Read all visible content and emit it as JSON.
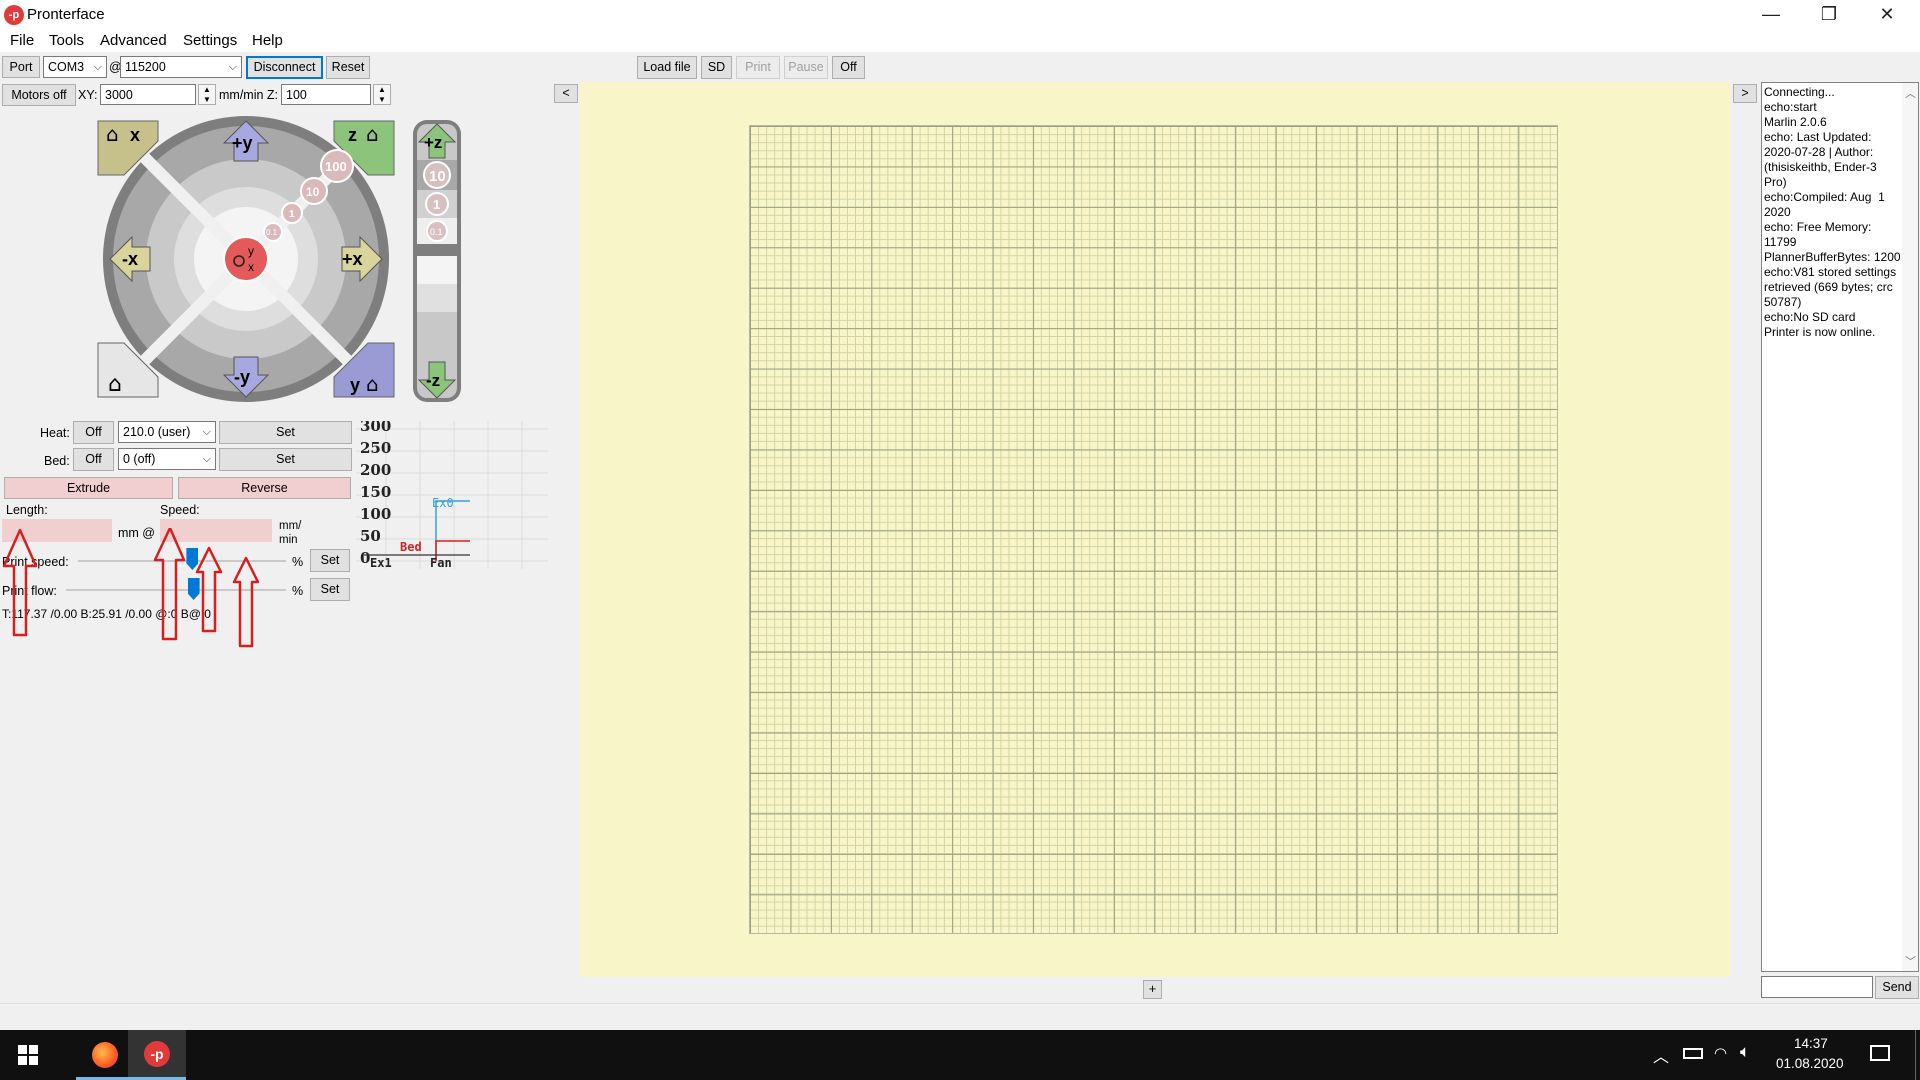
{
  "window": {
    "title": "Pronterface",
    "icon_text": "-p",
    "minimize": "—",
    "restore": "❐",
    "close": "✕"
  },
  "menu": [
    "File",
    "Tools",
    "Advanced",
    "Settings",
    "Help"
  ],
  "toolbar": {
    "port_label": "Port",
    "port_value": "COM3",
    "at_symbol": "@",
    "baud_value": "115200",
    "disconnect_label": "Disconnect",
    "reset_label": "Reset",
    "load_file_label": "Load file",
    "sd_label": "SD",
    "print_label": "Print",
    "pause_label": "Pause",
    "off_label": "Off",
    "collapse_left": "<",
    "collapse_right": ">"
  },
  "motion": {
    "motors_off_label": "Motors off",
    "xy_label": "XY:",
    "xy_value": "3000",
    "xy_unit": "mm/min Z:",
    "z_value": "100"
  },
  "jog": {
    "plus_y": "+y",
    "minus_y": "-y",
    "plus_x": "+x",
    "minus_x": "-x",
    "home_x": "x",
    "home_z": "z",
    "home_y": "y",
    "center_y": "y",
    "center_x": "x",
    "steps": [
      "100",
      "10",
      "1",
      "0.1"
    ],
    "plus_z": "+z",
    "minus_z": "-z",
    "z_steps": [
      "10",
      "1",
      "0.1"
    ]
  },
  "temps": {
    "heat_label": "Heat:",
    "heat_off": "Off",
    "heat_value": "210.0 (user)",
    "heat_set": "Set",
    "bed_label": "Bed:",
    "bed_off": "Off",
    "bed_value": "0 (off)",
    "bed_set": "Set"
  },
  "extrude": {
    "extrude_label": "Extrude",
    "reverse_label": "Reverse",
    "length_label": "Length:",
    "speed_label": "Speed:",
    "mm_at": "mm @",
    "mm_min_line1": "mm/",
    "mm_min_line2": "min",
    "print_speed_label": "Print speed:",
    "print_flow_label": "Print flow:",
    "percent": "%",
    "set": "Set",
    "print_speed_level": 0.55,
    "print_flow_level": 0.58
  },
  "status_line": "T:117.37 /0.00 B:25.91 /0.00 @:0 B@:0",
  "graph": {
    "ticks": [
      "300",
      "250",
      "200",
      "150",
      "100",
      "50",
      "0"
    ],
    "ex0_label": "Ex0",
    "ex1_label": "Ex1",
    "bed_label": "Bed",
    "fan_label": "Fan",
    "ex0_color": "#3aa0d8",
    "bed_color": "#d82020"
  },
  "plater_add": "+",
  "log": {
    "text": "Connecting...\necho:start\nMarlin 2.0.6\necho: Last Updated: 2020-07-28 | Author: (thisiskeithb, Ender-3 Pro)\necho:Compiled: Aug  1 2020\necho: Free Memory: 11799\nPlannerBufferBytes: 1200\necho:V81 stored settings retrieved (669 bytes; crc 50787)\necho:No SD card\nPrinter is now online.",
    "send_label": "Send",
    "input_value": ""
  },
  "taskbar": {
    "time": "14:37",
    "date": "01.08.2020"
  },
  "colors": {
    "plater_bg": "#f8f6c8",
    "annotation_arrow": "#d42020",
    "accent": "#0078d7"
  }
}
